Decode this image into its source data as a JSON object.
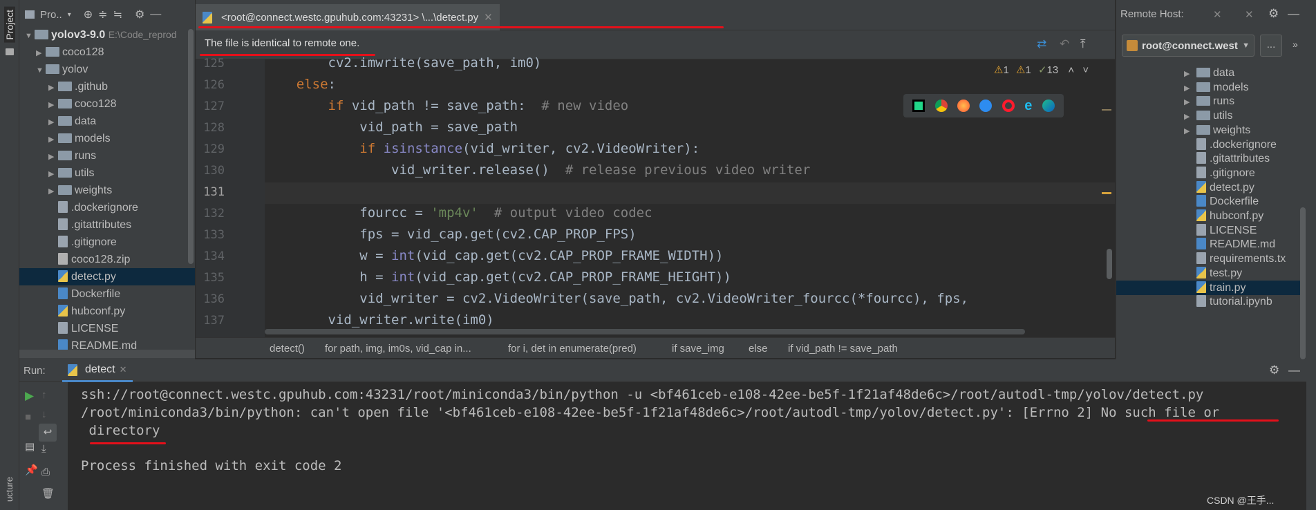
{
  "left_stripe": {
    "project_label": "Project",
    "structure_label": "ucture"
  },
  "project_panel": {
    "header_label": "Pro..",
    "root": {
      "name": "yolov3-9.0",
      "path": "E:\\Code_reprod"
    },
    "items": [
      {
        "label": "coco128",
        "type": "folder",
        "level": 1,
        "expanded": false
      },
      {
        "label": "yolov",
        "type": "folder",
        "level": 1,
        "expanded": true
      },
      {
        "label": ".github",
        "type": "folder",
        "level": 2,
        "expanded": false
      },
      {
        "label": "coco128",
        "type": "folder",
        "level": 2,
        "expanded": false
      },
      {
        "label": "data",
        "type": "folder",
        "level": 2,
        "expanded": false
      },
      {
        "label": "models",
        "type": "folder",
        "level": 2,
        "expanded": false
      },
      {
        "label": "runs",
        "type": "folder",
        "level": 2,
        "expanded": false
      },
      {
        "label": "utils",
        "type": "folder",
        "level": 2,
        "expanded": false
      },
      {
        "label": "weights",
        "type": "folder",
        "level": 2,
        "expanded": false
      },
      {
        "label": ".dockerignore",
        "type": "file",
        "level": 2
      },
      {
        "label": ".gitattributes",
        "type": "file",
        "level": 2
      },
      {
        "label": ".gitignore",
        "type": "file",
        "level": 2
      },
      {
        "label": "coco128.zip",
        "type": "zip",
        "level": 2
      },
      {
        "label": "detect.py",
        "type": "py",
        "level": 2,
        "selected": true
      },
      {
        "label": "Dockerfile",
        "type": "docker",
        "level": 2
      },
      {
        "label": "hubconf.py",
        "type": "py",
        "level": 2
      },
      {
        "label": "LICENSE",
        "type": "file",
        "level": 2
      },
      {
        "label": "README.md",
        "type": "md",
        "level": 2
      }
    ]
  },
  "editor": {
    "tab_label": "<root@connect.westc.gpuhub.com:43231> \\...\\detect.py",
    "banner": "The file is identical to remote one.",
    "inspections": {
      "warnings_a": "1",
      "warnings_b": "1",
      "weak_warnings": "13"
    },
    "browser_icons": [
      "pycharm-icon",
      "chrome-icon",
      "firefox-icon",
      "safari-icon",
      "opera-icon",
      "ie-icon",
      "edge-icon"
    ],
    "line_numbers": [
      "125",
      "126",
      "127",
      "128",
      "129",
      "130",
      "131",
      "132",
      "133",
      "134",
      "135",
      "136",
      "137"
    ],
    "breadcrumb": [
      "detect()",
      "for path, img, im0s, vid_cap in...",
      "for i, det in enumerate(pred)",
      "if save_img",
      "else",
      "if vid_path != save_path"
    ]
  },
  "remote_panel": {
    "title": "Remote Host:",
    "host": "root@connect.west",
    "more_button": "...",
    "items": [
      {
        "label": "data",
        "type": "folder"
      },
      {
        "label": "models",
        "type": "folder"
      },
      {
        "label": "runs",
        "type": "folder"
      },
      {
        "label": "utils",
        "type": "folder"
      },
      {
        "label": "weights",
        "type": "folder"
      },
      {
        "label": ".dockerignore",
        "type": "file"
      },
      {
        "label": ".gitattributes",
        "type": "file"
      },
      {
        "label": ".gitignore",
        "type": "file"
      },
      {
        "label": "detect.py",
        "type": "py"
      },
      {
        "label": "Dockerfile",
        "type": "docker"
      },
      {
        "label": "hubconf.py",
        "type": "py"
      },
      {
        "label": "LICENSE",
        "type": "file"
      },
      {
        "label": "README.md",
        "type": "md"
      },
      {
        "label": "requirements.tx",
        "type": "file"
      },
      {
        "label": "test.py",
        "type": "py"
      },
      {
        "label": "train.py",
        "type": "py",
        "selected": true
      },
      {
        "label": "tutorial.ipynb",
        "type": "file"
      }
    ]
  },
  "run_panel": {
    "run_label": "Run:",
    "tab_label": "detect",
    "console": {
      "line1": "ssh://root@connect.westc.gpuhub.com:43231/root/miniconda3/bin/python -u <bf461ceb-e108-42ee-be5f-1f21af48de6c>/root/autodl-tmp/yolov/detect.py",
      "line2": "/root/miniconda3/bin/python: can't open file '<bf461ceb-e108-42ee-be5f-1f21af48de6c>/root/autodl-tmp/yolov/detect.py': [Errno 2] No such file or",
      "line3": " directory",
      "line4": "Process finished with exit code 2"
    }
  },
  "watermark": "CSDN @王手...",
  "colors": {
    "keyword": "#cc7832",
    "builtin": "#8888c6",
    "string": "#6a8759",
    "comment": "#808080",
    "annotation": "#e5101a"
  }
}
